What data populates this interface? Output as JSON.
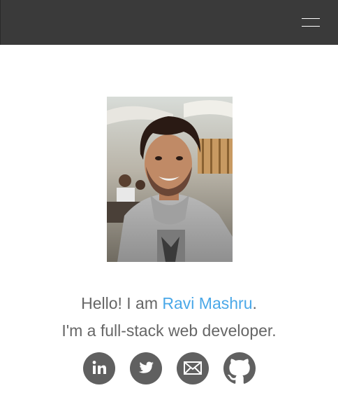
{
  "header": {
    "menu_icon": "hamburger-menu-icon"
  },
  "profile": {
    "photo": "profile-photo",
    "greeting_prefix": "Hello! I am ",
    "name": "Ravi Mashru",
    "greeting_suffix": ".",
    "tagline": "I'm a full-stack web developer."
  },
  "social": [
    {
      "icon": "linkedin-icon"
    },
    {
      "icon": "twitter-icon"
    },
    {
      "icon": "email-icon"
    },
    {
      "icon": "github-icon"
    }
  ],
  "colors": {
    "navbar": "#3a3a3a",
    "accent": "#4aa8e8",
    "text": "#666666",
    "icon_bg": "#606060"
  }
}
